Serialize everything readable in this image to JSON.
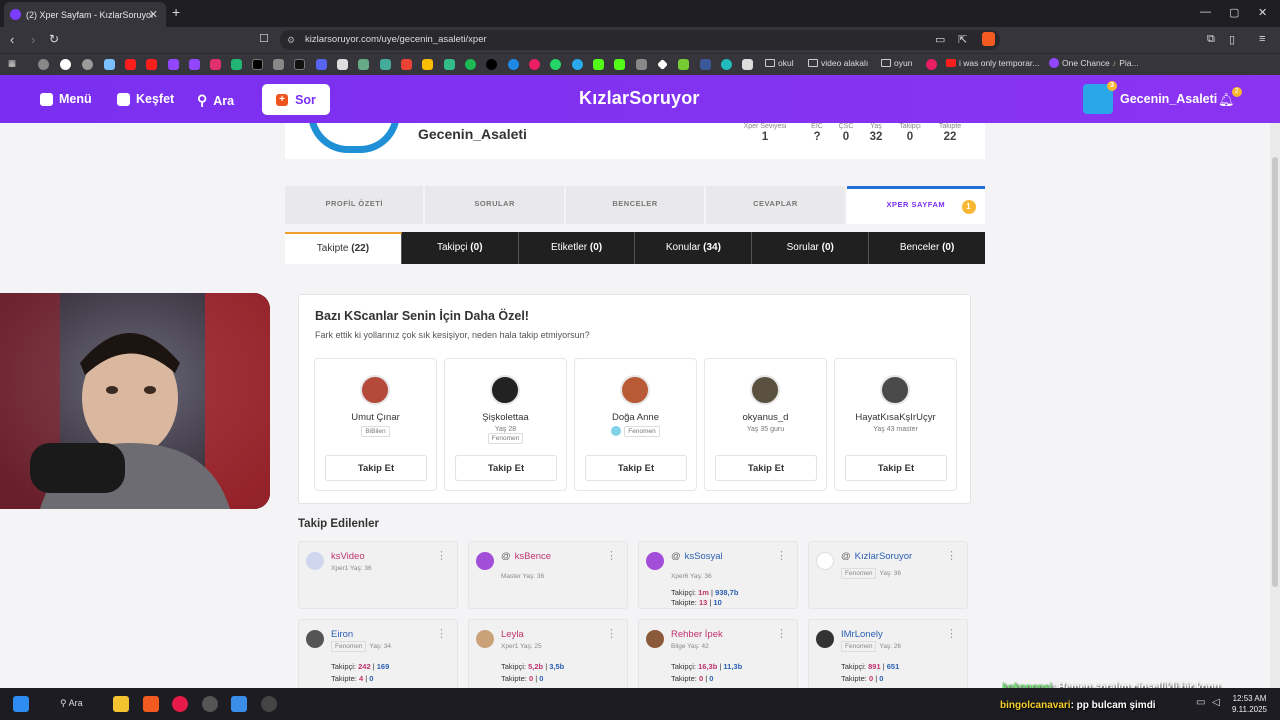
{
  "browser": {
    "tab_title": "(2) Xper Sayfam - KızlarSoruyor",
    "url": "kizlarsoruyor.com/uye/gecenin_asaleti/xper",
    "bookmarks": [
      "okul",
      "video alakalı",
      "oyun",
      "i was only temporar...",
      "One Chance",
      "Pia..."
    ]
  },
  "header": {
    "menu_label": "Menü",
    "explore_label": "Keşfet",
    "search_label": "Ara",
    "ask_label": "Sor",
    "logo": "KızlarSoruyor",
    "username": "Gecenin_Asaleti",
    "avatar_badge": "3",
    "notif_badge": "2"
  },
  "profile": {
    "name": "Gecenin_Asaleti",
    "stats": [
      {
        "label": "Xper Seviyesi",
        "value": "1"
      },
      {
        "label": "EIC",
        "value": "?"
      },
      {
        "label": "ÇSC",
        "value": "0"
      },
      {
        "label": "Yaş",
        "value": "32"
      },
      {
        "label": "Takipçi",
        "value": "0"
      },
      {
        "label": "Takipte",
        "value": "22"
      }
    ]
  },
  "main_tabs": [
    "PROFİL ÖZETİ",
    "SORULAR",
    "BENCELER",
    "CEVAPLAR",
    "XPER SAYFAM"
  ],
  "main_tab_badge": "1",
  "sub_tabs": [
    {
      "label": "Takipte",
      "count": "(22)"
    },
    {
      "label": "Takipçi",
      "count": "(0)"
    },
    {
      "label": "Etiketler",
      "count": "(0)"
    },
    {
      "label": "Konular",
      "count": "(34)"
    },
    {
      "label": "Sorular",
      "count": "(0)"
    },
    {
      "label": "Benceler",
      "count": "(0)"
    }
  ],
  "suggest": {
    "title": "Bazı KScanlar Senin İçin Daha Özel!",
    "subtitle": "Fark ettik ki yollarınız çok sık kesişiyor, neden hala takip etmiyorsun?",
    "follow_label": "Takip Et",
    "users": [
      {
        "name": "Umut Çınar",
        "meta": "",
        "tag": "BiBilen",
        "color": "#b44a3a"
      },
      {
        "name": "Şişkolettaa",
        "meta": "Yaş 28",
        "tag": "Fenomen",
        "color": "#222"
      },
      {
        "name": "Doğa Anne",
        "meta": "",
        "tag": "Fenomen",
        "color": "#b85a35"
      },
      {
        "name": "okyanus_d",
        "meta": "Yaş 35 guru",
        "tag": "",
        "color": "#5a5040"
      },
      {
        "name": "HayatKısaKşIrUçyr",
        "meta": "Yaş 43 master",
        "tag": "",
        "color": "#4a4a4a"
      }
    ]
  },
  "following": {
    "title": "Takip Edilenler",
    "takipci_label": "Takipçi:",
    "takipte_label": "Takipte:",
    "items": [
      {
        "name": "ksVideo",
        "meta": "Xper1 Yaş: 36",
        "tag": "",
        "s1a": "",
        "s1b": "",
        "s2a": "",
        "s2b": ""
      },
      {
        "name": "ksBence",
        "meta": "Master Yaş: 36",
        "tag": "",
        "s1a": "",
        "s1b": "",
        "s2a": "",
        "s2b": ""
      },
      {
        "name": "ksSosyal",
        "meta": "Xper6 Yaş: 36",
        "tag": "",
        "s1a": "1m",
        "s1b": "938,7b",
        "s2a": "13",
        "s2b": "10"
      },
      {
        "name": "KızlarSoruyor",
        "meta": "Yaş: 36",
        "tag": "Fenomen",
        "s1a": "",
        "s1b": "",
        "s2a": "",
        "s2b": ""
      },
      {
        "name": "Eiron",
        "meta": "Yaş: 34",
        "tag": "Fenomen",
        "s1a": "242",
        "s1b": "169",
        "s2a": "4",
        "s2b": "0"
      },
      {
        "name": "Leyla",
        "meta": "Xper1 Yaş: 25",
        "tag": "",
        "s1a": "5,2b",
        "s1b": "3,5b",
        "s2a": "0",
        "s2b": "0"
      },
      {
        "name": "Rehber İpek",
        "meta": "Bilge Yaş: 42",
        "tag": "",
        "s1a": "16,3b",
        "s1b": "11,3b",
        "s2a": "0",
        "s2b": "0"
      },
      {
        "name": "IMrLonely",
        "meta": "Yaş: 26",
        "tag": "Fenomen",
        "s1a": "891",
        "s1b": "651",
        "s2a": "0",
        "s2b": "0"
      }
    ]
  },
  "chat": [
    {
      "user": "kokopopsi",
      "text": ": Hemen soralım cinsellikli bir konu"
    },
    {
      "user": "bingolcanavari",
      "text": ": pp bulcam şimdi"
    }
  ],
  "taskbar": {
    "search": "Ara",
    "time": "12:53 AM",
    "date": "9.11.2025"
  }
}
